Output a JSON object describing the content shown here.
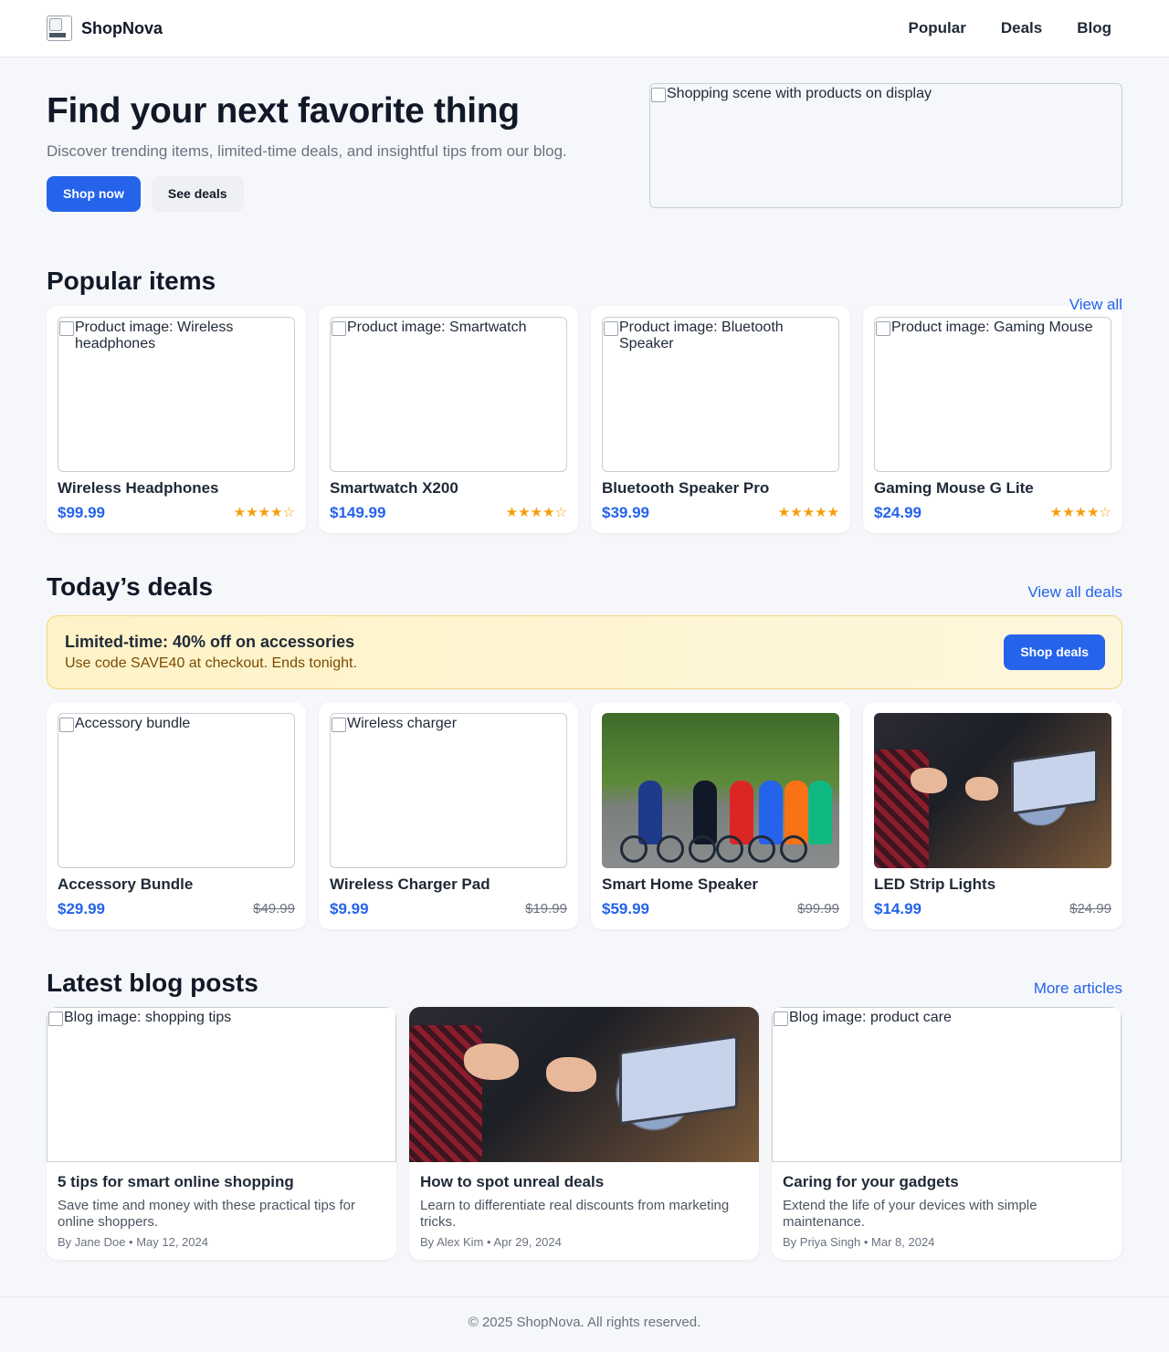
{
  "brand": {
    "name": "ShopNova",
    "logo_alt": "ShopNova logo"
  },
  "nav": {
    "items": [
      "Popular",
      "Deals",
      "Blog"
    ]
  },
  "hero": {
    "title": "Find your next favorite thing",
    "subtitle": "Discover trending items, limited-time deals, and insightful tips from our blog.",
    "primary_button": "Shop now",
    "secondary_button": "See deals",
    "image_alt": "Shopping scene with products on display"
  },
  "popular": {
    "title": "Popular items",
    "link": "View all",
    "items": [
      {
        "image_alt": "Product image: Wireless headphones",
        "name": "Wireless Headphones",
        "price": "$99.99",
        "rating": 4
      },
      {
        "image_alt": "Product image: Smartwatch",
        "name": "Smartwatch X200",
        "price": "$149.99",
        "rating": 4
      },
      {
        "image_alt": "Product image: Bluetooth Speaker",
        "name": "Bluetooth Speaker Pro",
        "price": "$39.99",
        "rating": 5
      },
      {
        "image_alt": "Product image: Gaming Mouse",
        "name": "Gaming Mouse G Lite",
        "price": "$24.99",
        "rating": 4
      }
    ]
  },
  "deals": {
    "title": "Today’s deals",
    "link": "View all deals",
    "banner": {
      "title": "Limited-time: 40% off on accessories",
      "subtitle": "Use code SAVE40 at checkout. Ends tonight.",
      "button": "Shop deals"
    },
    "items": [
      {
        "image_alt": "Accessory bundle",
        "name": "Accessory Bundle",
        "price": "$29.99",
        "old_price": "$49.99"
      },
      {
        "image_alt": "Wireless charger",
        "name": "Wireless Charger Pad",
        "price": "$9.99",
        "old_price": "$19.99"
      },
      {
        "image_alt": "",
        "name": "Smart Home Speaker",
        "price": "$59.99",
        "old_price": "$99.99"
      },
      {
        "image_alt": "",
        "name": "LED Strip Lights",
        "price": "$14.99",
        "old_price": "$24.99"
      }
    ]
  },
  "blog": {
    "title": "Latest blog posts",
    "link": "More articles",
    "posts": [
      {
        "image_alt": "Blog image: shopping tips",
        "title": "5 tips for smart online shopping",
        "desc": "Save time and money with these practical tips for online shoppers.",
        "meta": "By Jane Doe • May 12, 2024"
      },
      {
        "image_alt": "",
        "title": "How to spot unreal deals",
        "desc": "Learn to differentiate real discounts from marketing tricks.",
        "meta": "By Alex Kim • Apr 29, 2024"
      },
      {
        "image_alt": "Blog image: product care",
        "title": "Caring for your gadgets",
        "desc": "Extend the life of your devices with simple maintenance.",
        "meta": "By Priya Singh • Mar 8, 2024"
      }
    ]
  },
  "footer": {
    "text": "© 2025 ShopNova. All rights reserved."
  },
  "colors": {
    "accent": "#2563eb",
    "star": "#f59e0b",
    "banner_bg": "#fef3c7",
    "banner_border": "#f6d57a"
  }
}
